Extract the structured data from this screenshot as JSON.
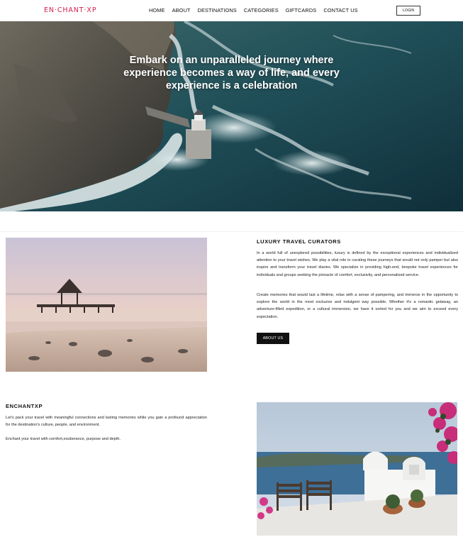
{
  "nav": {
    "logo": "EN·CHANT·XP",
    "items": [
      "HOME",
      "ABOUT",
      "DESTINATIONS",
      "CATEGORIES",
      "GIFTCARDS",
      "CONTACT US"
    ],
    "login_label": "LOGIN"
  },
  "hero": {
    "title": "Embark on an unparalleled journey where experience becomes a way of life, and every experience is a celebration"
  },
  "curators": {
    "heading": "LUXURY TRAVEL CURATORS",
    "paragraph1": "In a world full of unexplored possibilities, luxury is defined by the exceptional experiences and individualized attention to your travel wishes. We play a vital role in curating these journeys that would not only pamper but also inspire and transform your travel diaries. We specialize in providing high-end, bespoke travel experiences for individuals and groups seeking the pinnacle of comfort, exclusivity, and personalized service.",
    "paragraph2": "Create memories that would last a lifetime, relax with a sense of pampering, and immerse in the opportunity to explore the world in the most exclusive and indulgent way possible. Whether it's a romantic getaway, an adventure-filled expedition, or a cultural immersion, we have it sorted for you and we aim to exceed every expectation.",
    "button_label": "ABOUT US"
  },
  "enchantxp": {
    "heading": "ENCHANTXP",
    "paragraph1": "Let's pack your travel with meaningful connections and lasting memories while you gain a profound appreciation for the destination's culture, people, and environment.",
    "paragraph2": "Enchant your travel with comfort,exuberance, purpose and depth."
  },
  "colors": {
    "brand": "#d21f4a",
    "button": "#111111"
  }
}
